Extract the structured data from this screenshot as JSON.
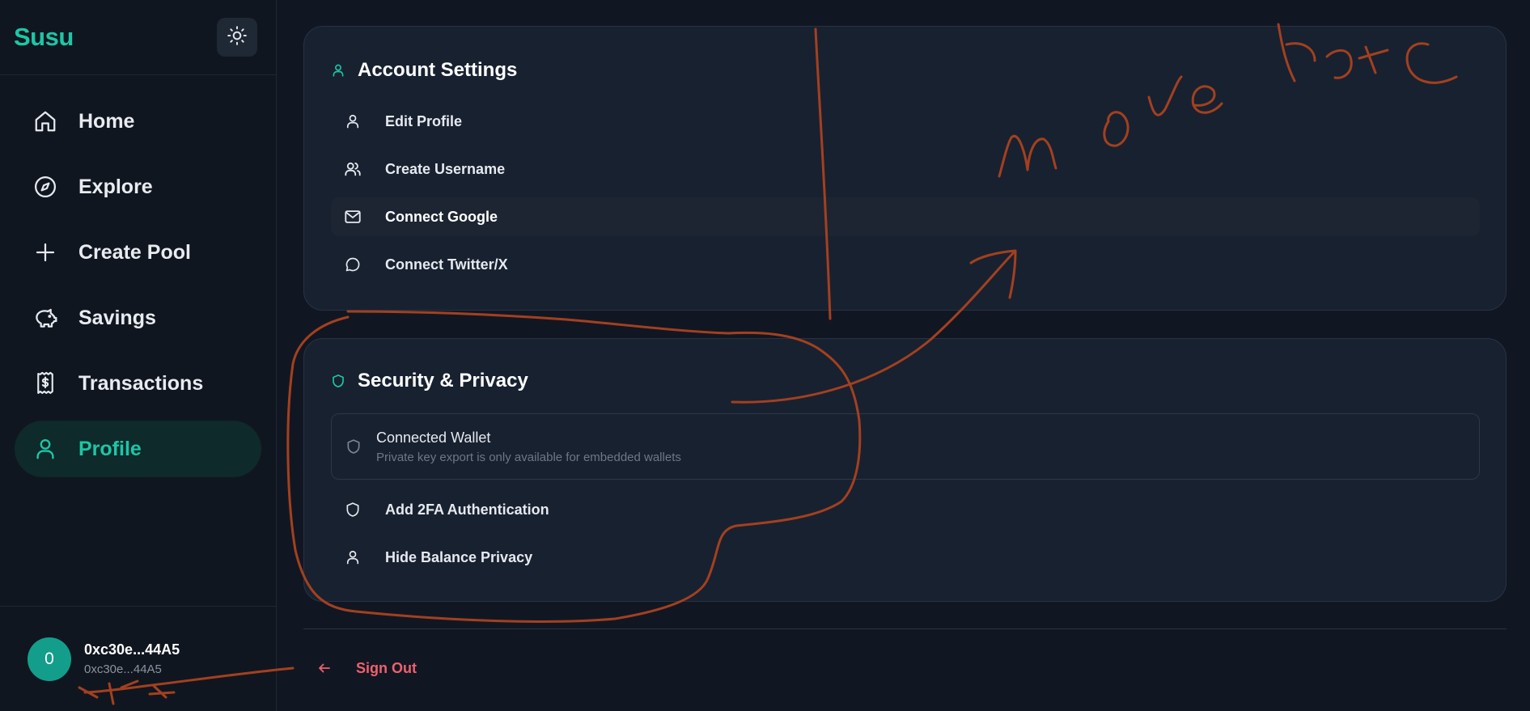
{
  "brand": {
    "name": "Susu"
  },
  "theme_toggle": {
    "icon": "sun-icon"
  },
  "sidebar": {
    "items": [
      {
        "label": "Home",
        "icon": "home-icon"
      },
      {
        "label": "Explore",
        "icon": "compass-icon"
      },
      {
        "label": "Create Pool",
        "icon": "plus-icon"
      },
      {
        "label": "Savings",
        "icon": "piggy-bank-icon"
      },
      {
        "label": "Transactions",
        "icon": "receipt-icon"
      },
      {
        "label": "Profile",
        "icon": "user-icon",
        "active": true
      }
    ]
  },
  "user": {
    "avatar_initial": "0",
    "name": "0xc30e...44A5",
    "address": "0xc30e...44A5"
  },
  "account_settings": {
    "title": "Account Settings",
    "items": [
      {
        "label": "Edit Profile",
        "icon": "user-icon"
      },
      {
        "label": "Create Username",
        "icon": "users-icon"
      },
      {
        "label": "Connect Google",
        "icon": "mail-icon"
      },
      {
        "label": "Connect Twitter/X",
        "icon": "chat-bubble-icon"
      }
    ]
  },
  "security": {
    "title": "Security & Privacy",
    "wallet": {
      "title": "Connected Wallet",
      "subtitle": "Private key export is only available for embedded wallets"
    },
    "items": [
      {
        "label": "Add 2FA Authentication",
        "icon": "shield-icon"
      },
      {
        "label": "Hide Balance Privacy",
        "icon": "user-icon"
      }
    ]
  },
  "sign_out": {
    "label": "Sign Out",
    "icon": "arrow-left-icon"
  },
  "colors": {
    "accent": "#1dc6a6",
    "danger": "#f0606e",
    "background": "#111722",
    "card": "#182130",
    "annotation": "#a3401f"
  }
}
